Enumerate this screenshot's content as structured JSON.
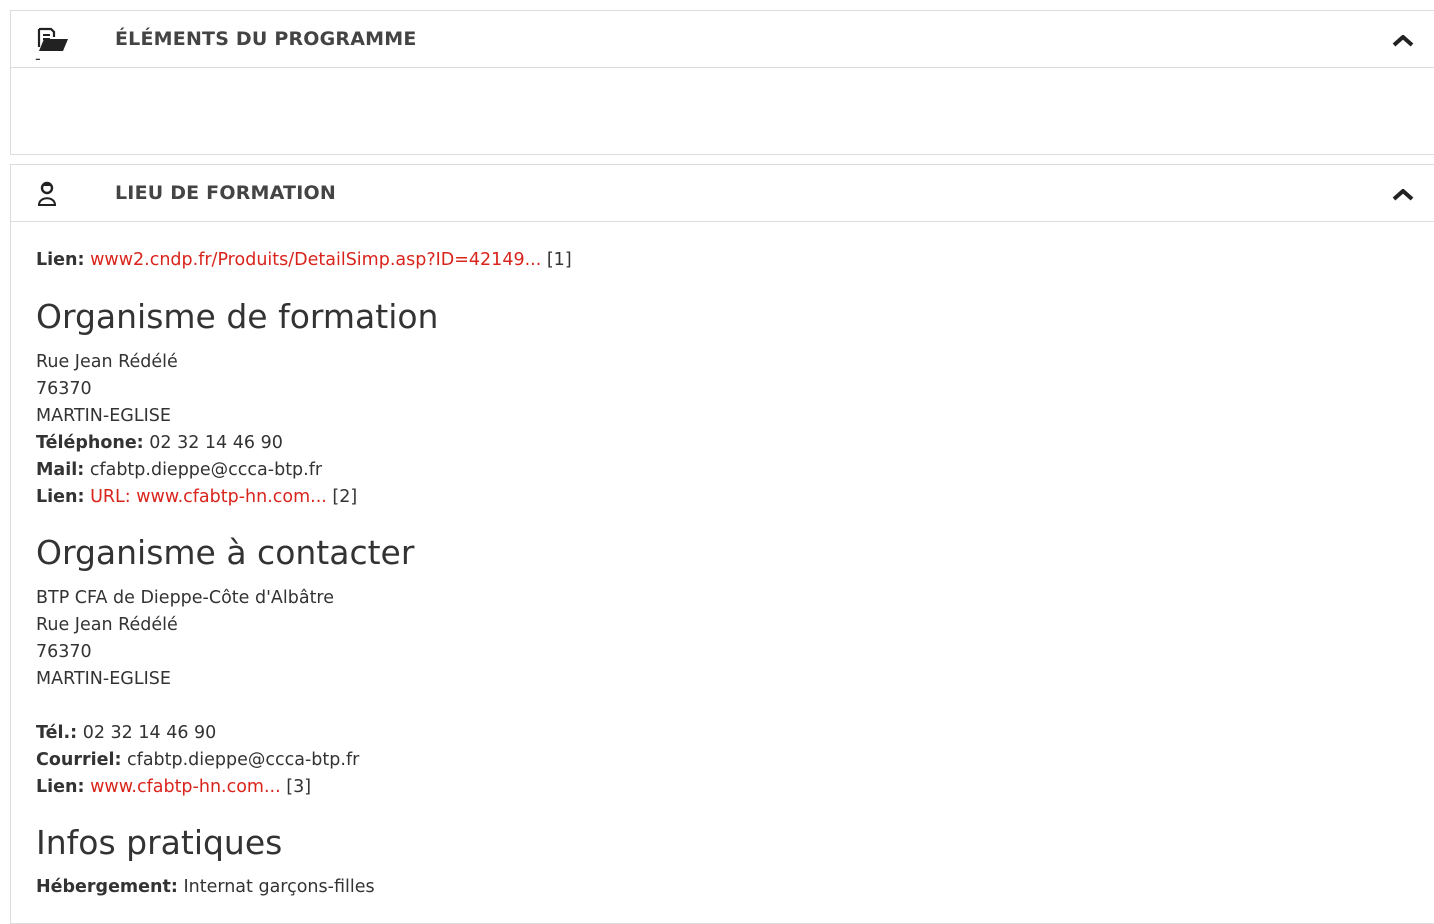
{
  "panel_programme": {
    "icon": "folder-open-icon",
    "title": "ÉLÉMENTS DU PROGRAMME",
    "toggle_icon": "chevron-up-icon",
    "content": "-"
  },
  "panel_lieu": {
    "icon": "person-icon",
    "title": "LIEU DE FORMATION",
    "toggle_icon": "chevron-up-icon",
    "lien_label": "Lien:",
    "lien_text": "www2.cndp.fr/Produits/DetailSimp.asp?ID=42149...",
    "lien_ref": "[1]",
    "organisme_formation": {
      "heading": "Organisme de formation",
      "street": "Rue Jean Rédélé",
      "postcode": "76370",
      "city": "MARTIN-EGLISE",
      "phone_label": "Téléphone:",
      "phone": "02 32 14 46 90",
      "mail_label": "Mail:",
      "mail": "cfabtp.dieppe@ccca-btp.fr",
      "lien_label": "Lien:",
      "lien_text": "URL: www.cfabtp-hn.com...",
      "lien_ref": "[2]"
    },
    "organisme_contact": {
      "heading": "Organisme à contacter",
      "name": "BTP CFA de Dieppe-Côte d'Albâtre",
      "street": "Rue Jean Rédélé",
      "postcode": "76370",
      "city": "MARTIN-EGLISE",
      "tel_label": "Tél.:",
      "tel": "02 32 14 46 90",
      "courriel_label": "Courriel:",
      "courriel": "cfabtp.dieppe@ccca-btp.fr",
      "lien_label": "Lien:",
      "lien_text": "www.cfabtp-hn.com...",
      "lien_ref": "[3]"
    },
    "infos_pratiques": {
      "heading": "Infos pratiques",
      "hebergement_label": "Hébergement:",
      "hebergement": "Internat garçons-filles"
    }
  },
  "colors": {
    "link": "#d9241c",
    "text": "#333333",
    "border": "#dcdcdc"
  }
}
